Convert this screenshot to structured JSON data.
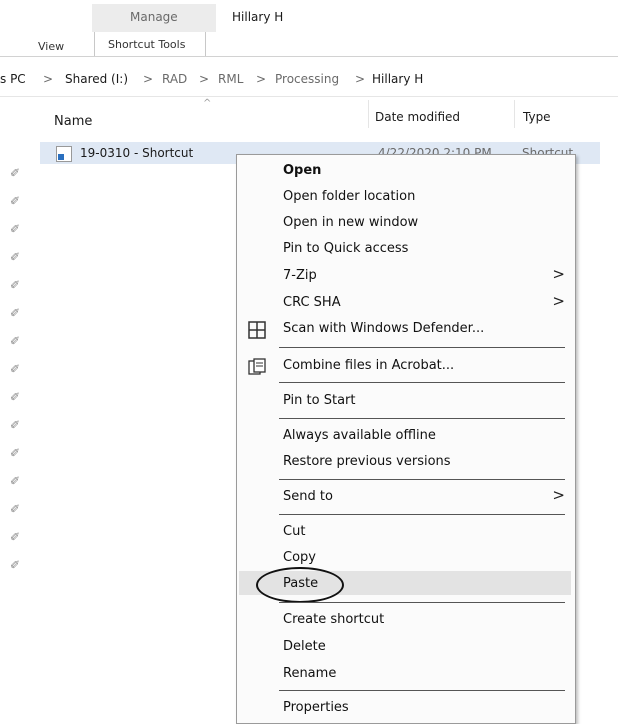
{
  "ribbon": {
    "manage_label": "Manage",
    "folder_title": "Hillary H",
    "view_label": "View",
    "shortcut_tools_label": "Shortcut Tools"
  },
  "breadcrumb": {
    "items": [
      "s PC",
      "Shared (I:)",
      "RAD",
      "RML",
      "Processing",
      "Hillary H"
    ],
    "separator": ">"
  },
  "file_list": {
    "columns": [
      "Name",
      "Date modified",
      "Type"
    ],
    "rows": [
      {
        "name": "19-0310 - Shortcut",
        "date": "4/22/2020 2:10 PM",
        "type": "Shortcut"
      }
    ]
  },
  "context_menu": {
    "groups": [
      [
        "Open",
        "Open folder location",
        "Open in new window",
        "Pin to Quick access",
        "7-Zip",
        "CRC SHA",
        "Scan with Windows Defender..."
      ],
      [
        "Combine files in Acrobat..."
      ],
      [
        "Pin to Start"
      ],
      [
        "Always available offline",
        "Restore previous versions"
      ],
      [
        "Send to"
      ],
      [
        "Cut",
        "Copy",
        "Paste"
      ],
      [
        "Create shortcut",
        "Delete",
        "Rename"
      ],
      [
        "Properties"
      ]
    ],
    "submenu_items": [
      "7-Zip",
      "CRC SHA",
      "Send to"
    ],
    "highlighted_item": "Paste",
    "submenu_arrow": ">"
  },
  "colors": {
    "selection": "#dfe8f4",
    "menu_background": "#fbfbfb",
    "hover": "#e3e3e3"
  }
}
